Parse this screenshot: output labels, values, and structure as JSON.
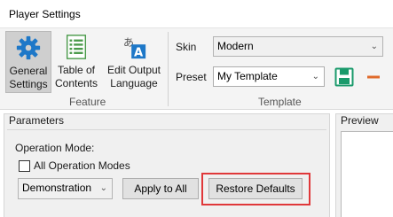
{
  "window": {
    "title": "Player Settings"
  },
  "ribbon": {
    "feature_group": {
      "label": "Feature",
      "buttons": [
        {
          "label": "General\nSettings",
          "icon": "gear-icon",
          "selected": true
        },
        {
          "label": "Table of\nContents",
          "icon": "toc-icon",
          "selected": false
        },
        {
          "label": "Edit Output\nLanguage",
          "icon": "language-icon",
          "selected": false
        }
      ]
    },
    "template_group": {
      "label": "Template",
      "skin_label": "Skin",
      "skin_value": "Modern",
      "preset_label": "Preset",
      "preset_value": "My Template",
      "save_icon": "save-icon",
      "remove_icon": "remove-icon"
    }
  },
  "parameters": {
    "header": "Parameters",
    "operation_mode_label": "Operation Mode:",
    "all_modes_checkbox_label": "All Operation Modes",
    "all_modes_checked": false,
    "mode_select_value": "Demonstration",
    "apply_button": "Apply to All",
    "restore_button": "Restore Defaults"
  },
  "preview": {
    "header": "Preview"
  },
  "colors": {
    "highlight": "#e0383a",
    "accent_blue": "#1e78c8",
    "save_green": "#1a9a6b",
    "remove_orange": "#e06b2c"
  }
}
